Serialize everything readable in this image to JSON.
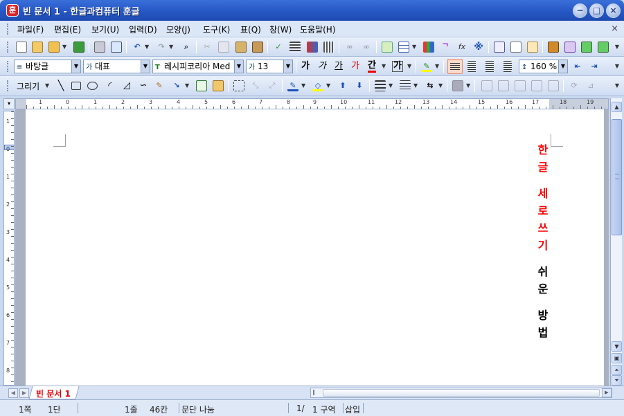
{
  "window": {
    "title": "빈 문서 1 - 한글과컴퓨터 훈글",
    "app_icon": "훈",
    "buttons": {
      "minimize": "−",
      "maximize": "□",
      "close": "×"
    }
  },
  "menu": {
    "items": [
      "파일(F)",
      "편집(E)",
      "보기(U)",
      "입력(D)",
      "모양(J)",
      "도구(K)",
      "표(Q)",
      "창(W)",
      "도움말(H)"
    ],
    "close": "×"
  },
  "format_bar": {
    "style": "바탕글",
    "style_icon": "≡",
    "font_category": "대표",
    "font_category_icon": "가",
    "font_name": "레시피코리아 Med",
    "font_icon": "T",
    "font_size": "13",
    "font_size_icon": "가",
    "buttons": {
      "bold": "가",
      "italic": "가",
      "underline": "가",
      "strike": "가",
      "color": "간",
      "shade": "가"
    },
    "line_spacing": "160 %",
    "line_spacing_icon": "↕"
  },
  "draw_bar": {
    "label": "그리기"
  },
  "ruler": {
    "h_numbers": [
      "1",
      "0",
      "1",
      "2",
      "3",
      "4",
      "5",
      "6",
      "7",
      "8",
      "9",
      "10",
      "11",
      "12",
      "13",
      "14",
      "15",
      "16",
      "17",
      "18",
      "19"
    ],
    "v_numbers": [
      "1",
      "0",
      "1",
      "2",
      "3",
      "4",
      "5",
      "6",
      "7",
      "8"
    ]
  },
  "document": {
    "vertical_text_red": [
      "한",
      "글",
      "",
      "세",
      "로",
      "쓰",
      "기"
    ],
    "vertical_text_black": [
      "쉬",
      "운",
      "",
      "방",
      "법"
    ]
  },
  "tabs": {
    "active": "빈 문서 1"
  },
  "status": {
    "page": "1쪽",
    "column": "1단",
    "line": "1줄",
    "char": "46칸",
    "paragraph": "문단 나눔",
    "page_total": "1/",
    "section": "1 구역",
    "mode": "삽입"
  }
}
